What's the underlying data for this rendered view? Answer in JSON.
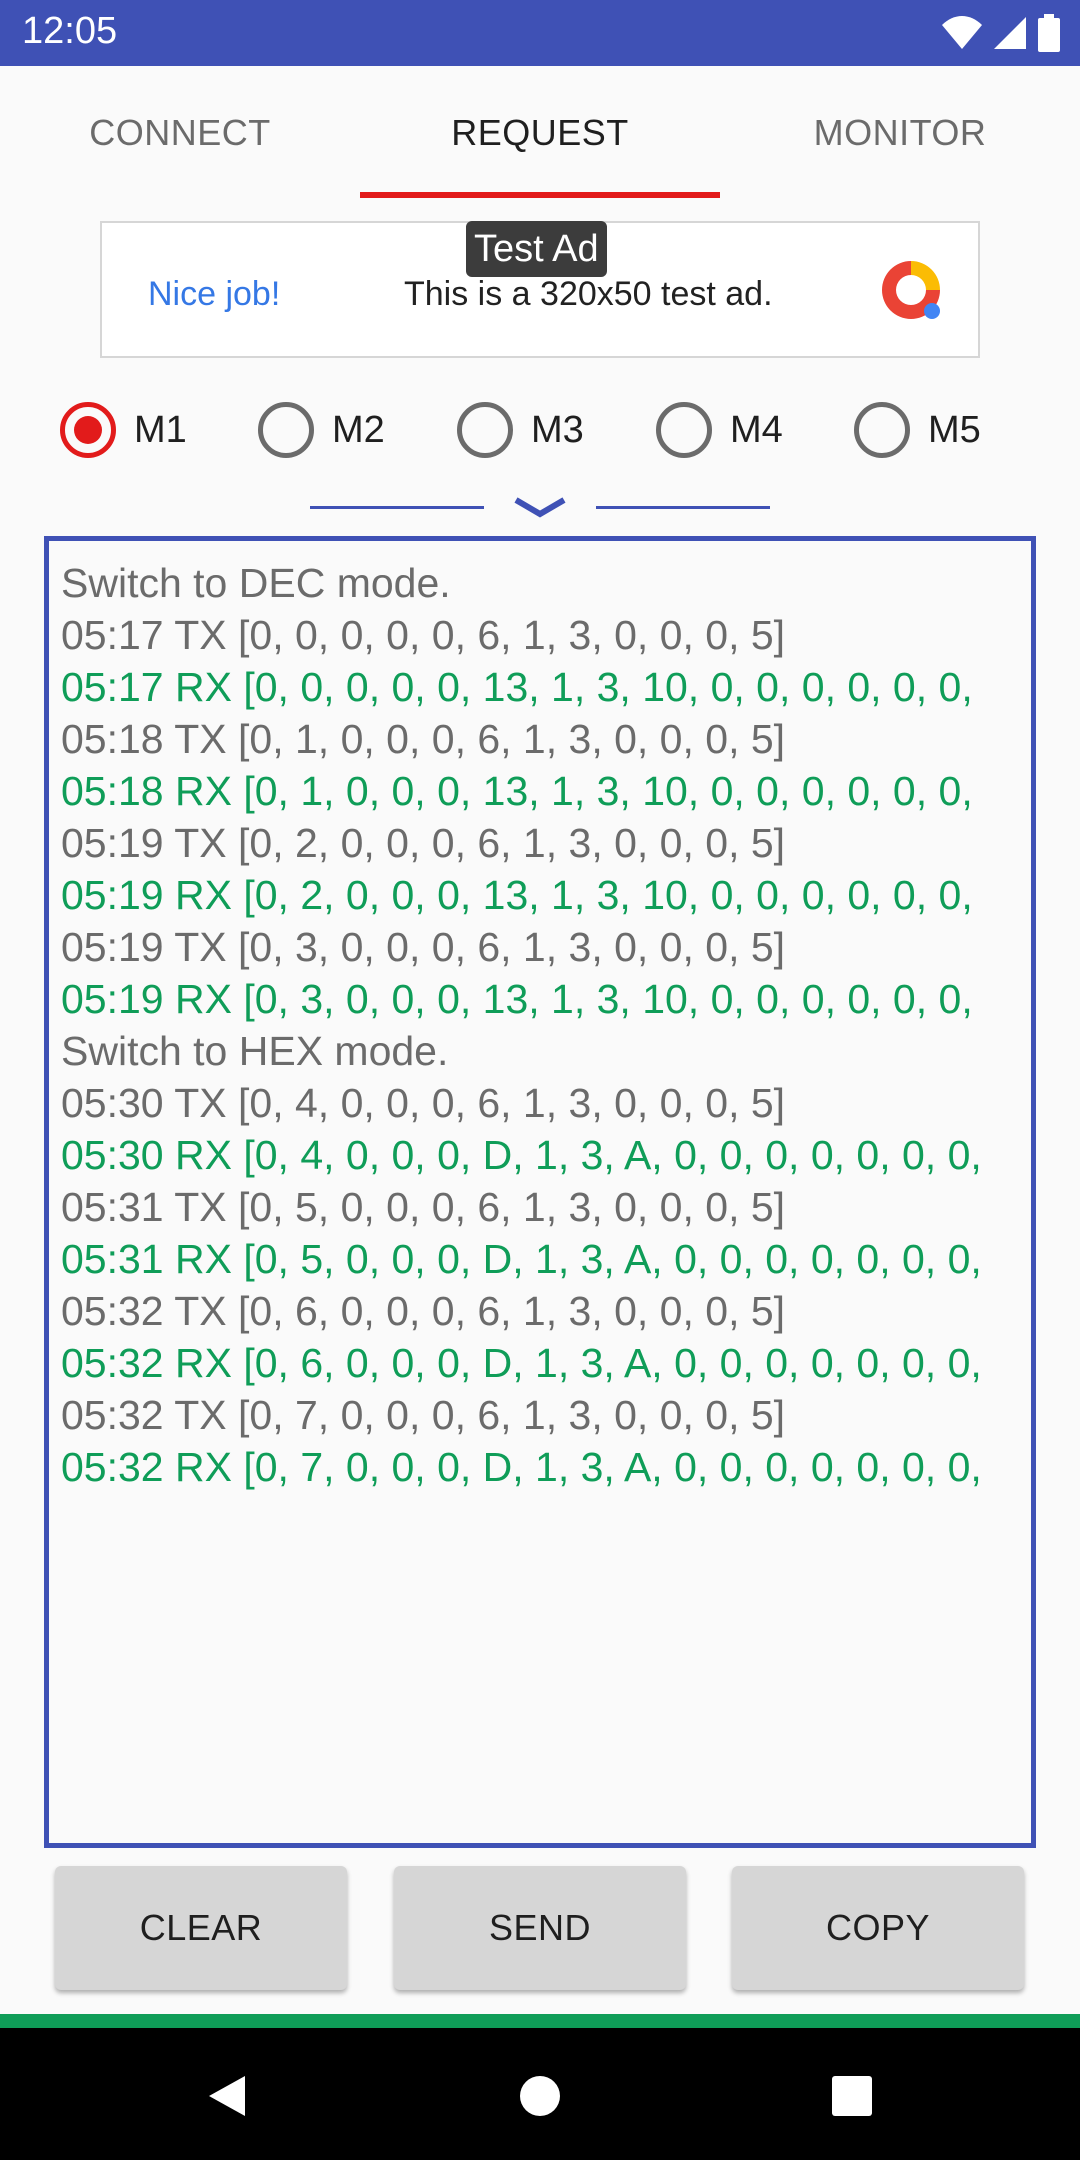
{
  "status": {
    "time": "12:05"
  },
  "tabs": [
    {
      "label": "CONNECT"
    },
    {
      "label": "REQUEST"
    },
    {
      "label": "MONITOR"
    }
  ],
  "ad": {
    "badge": "Test Ad",
    "nice": "Nice job!",
    "message": "This is a 320x50 test ad."
  },
  "radios": [
    {
      "label": "M1",
      "checked": true
    },
    {
      "label": "M2",
      "checked": false
    },
    {
      "label": "M3",
      "checked": false
    },
    {
      "label": "M4",
      "checked": false
    },
    {
      "label": "M5",
      "checked": false
    }
  ],
  "log": [
    {
      "text": "Switch to DEC mode.",
      "type": "info"
    },
    {
      "text": "05:17 TX [0, 0, 0, 0, 0, 6, 1, 3, 0, 0, 0, 5]",
      "type": "tx"
    },
    {
      "text": "05:17 RX [0, 0, 0, 0, 0, 13, 1, 3, 10, 0, 0, 0, 0, 0, 0,",
      "type": "rx"
    },
    {
      "text": "05:18 TX [0, 1, 0, 0, 0, 6, 1, 3, 0, 0, 0, 5]",
      "type": "tx"
    },
    {
      "text": "05:18 RX [0, 1, 0, 0, 0, 13, 1, 3, 10, 0, 0, 0, 0, 0, 0,",
      "type": "rx"
    },
    {
      "text": "05:19 TX [0, 2, 0, 0, 0, 6, 1, 3, 0, 0, 0, 5]",
      "type": "tx"
    },
    {
      "text": "05:19 RX [0, 2, 0, 0, 0, 13, 1, 3, 10, 0, 0, 0, 0, 0, 0,",
      "type": "rx"
    },
    {
      "text": "05:19 TX [0, 3, 0, 0, 0, 6, 1, 3, 0, 0, 0, 5]",
      "type": "tx"
    },
    {
      "text": "05:19 RX [0, 3, 0, 0, 0, 13, 1, 3, 10, 0, 0, 0, 0, 0, 0,",
      "type": "rx"
    },
    {
      "text": "Switch to HEX mode.",
      "type": "info"
    },
    {
      "text": "05:30 TX [0, 4, 0, 0, 0, 6, 1, 3, 0, 0, 0, 5]",
      "type": "tx"
    },
    {
      "text": "05:30 RX [0, 4, 0, 0, 0, D, 1, 3, A, 0, 0, 0, 0, 0, 0, 0,",
      "type": "rx"
    },
    {
      "text": "05:31 TX [0, 5, 0, 0, 0, 6, 1, 3, 0, 0, 0, 5]",
      "type": "tx"
    },
    {
      "text": "05:31 RX [0, 5, 0, 0, 0, D, 1, 3, A, 0, 0, 0, 0, 0, 0, 0,",
      "type": "rx"
    },
    {
      "text": "05:32 TX [0, 6, 0, 0, 0, 6, 1, 3, 0, 0, 0, 5]",
      "type": "tx"
    },
    {
      "text": "05:32 RX [0, 6, 0, 0, 0, D, 1, 3, A, 0, 0, 0, 0, 0, 0, 0,",
      "type": "rx"
    },
    {
      "text": "05:32 TX [0, 7, 0, 0, 0, 6, 1, 3, 0, 0, 0, 5]",
      "type": "tx"
    },
    {
      "text": "05:32 RX [0, 7, 0, 0, 0, D, 1, 3, A, 0, 0, 0, 0, 0, 0, 0,",
      "type": "rx"
    }
  ],
  "buttons": {
    "clear": "CLEAR",
    "send": "SEND",
    "copy": "COPY"
  },
  "colors": {
    "primary": "#3f51b5",
    "accent": "#e21b1b",
    "rx_text": "#0f9d58",
    "tx_text": "#6b6b6b"
  },
  "icons": [
    "wifi-icon",
    "signal-icon",
    "battery-icon",
    "chevron-down-icon",
    "ad-logo-icon",
    "back-icon",
    "home-icon",
    "recents-icon"
  ]
}
